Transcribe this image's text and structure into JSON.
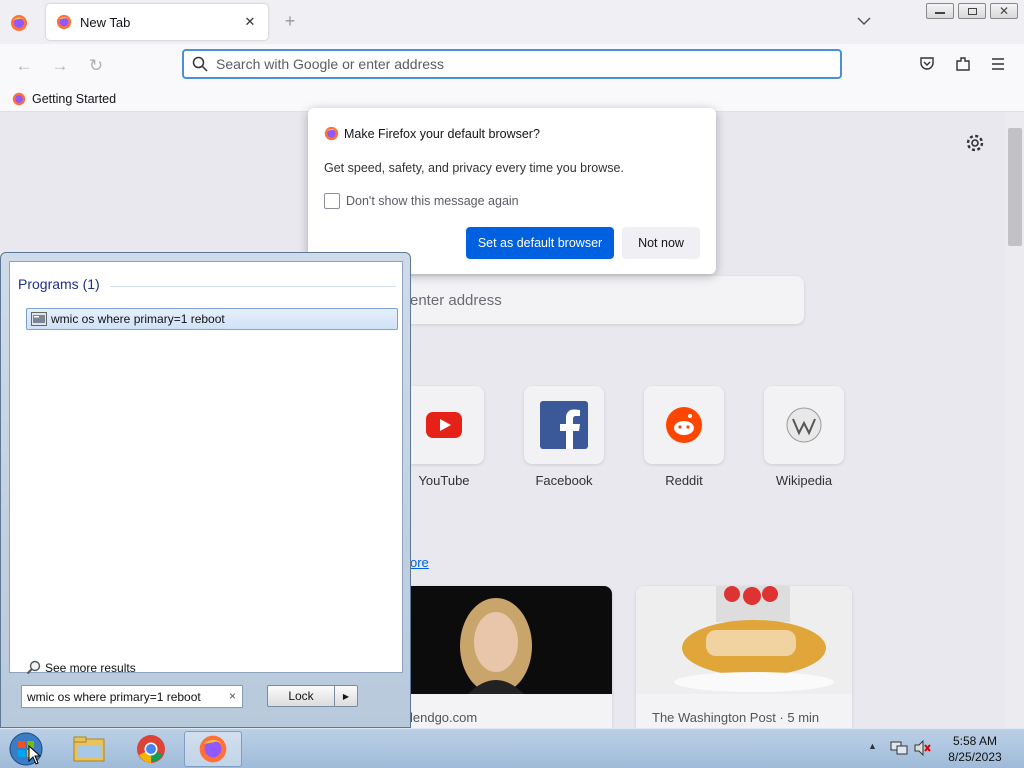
{
  "browser": {
    "tab_title": "New Tab",
    "new_tab_glyph": "+",
    "close_glyph": "✕",
    "url_placeholder": "Search with Google or enter address",
    "bookmark_label": "Getting Started"
  },
  "newtab": {
    "search_placeholder_partial": "enter address",
    "sites": [
      "YouTube",
      "Facebook",
      "Reddit",
      "Wikipedia"
    ],
    "more_link_partial": "ore",
    "stories": [
      {
        "source": "lendgo.com"
      },
      {
        "source": "The Washington Post · 5 min"
      }
    ]
  },
  "popup": {
    "title": "Make Firefox your default browser?",
    "body": "Get speed, safety, and privacy every time you browse.",
    "checkbox_label": "Don't show this message again",
    "primary_button": "Set as default browser",
    "secondary_button": "Not now"
  },
  "start_menu": {
    "section_header": "Programs (1)",
    "result_label": "wmic os where primary=1 reboot",
    "see_more": "See more results",
    "search_value": "wmic os where primary=1 reboot",
    "clear_glyph": "×",
    "lock_label": "Lock"
  },
  "taskbar": {
    "time": "5:58 AM",
    "date": "8/25/2023"
  },
  "colors": {
    "accent": "#0061e0",
    "urlbar_focus": "#4a90d9"
  }
}
